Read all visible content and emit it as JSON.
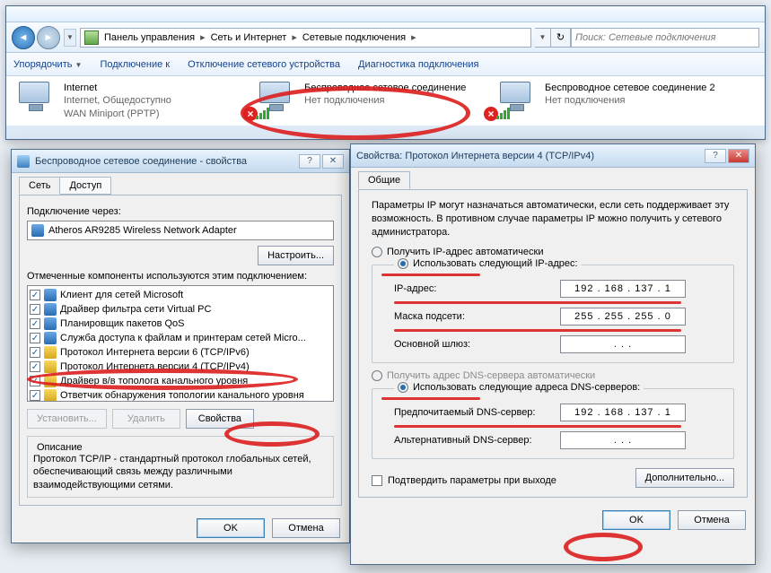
{
  "explorer": {
    "breadcrumb": [
      "Панель управления",
      "Сеть и Интернет",
      "Сетевые подключения"
    ],
    "search_placeholder": "Поиск: Сетевые подключения",
    "cmdbar": {
      "organize": "Упорядочить",
      "connect": "Подключение к",
      "disable": "Отключение сетевого устройства",
      "diagnose": "Диагностика подключения"
    },
    "items": [
      {
        "name": "Internet",
        "l2": "Internet, Общедоступно",
        "l3": "WAN Miniport (PPTP)",
        "red_x": false,
        "bars": false
      },
      {
        "name": "Беспроводное сетевое соединение",
        "l2": "Нет подключения",
        "l3": "",
        "red_x": true,
        "bars": true
      },
      {
        "name": "Беспроводное сетевое соединение 2",
        "l2": "Нет подключения",
        "l3": "",
        "red_x": true,
        "bars": true
      }
    ]
  },
  "dlg_props": {
    "title": "Беспроводное сетевое соединение - свойства",
    "tabs": {
      "net": "Сеть",
      "access": "Доступ"
    },
    "connect_via": "Подключение через:",
    "adapter": "Atheros AR9285 Wireless Network Adapter",
    "configure": "Настроить...",
    "components_label": "Отмеченные компоненты используются этим подключением:",
    "components": [
      "Клиент для сетей Microsoft",
      "Драйвер фильтра сети Virtual PC",
      "Планировщик пакетов QoS",
      "Служба доступа к файлам и принтерам сетей Micro...",
      "Протокол Интернета версии 6 (TCP/IPv6)",
      "Протокол Интернета версии 4 (TCP/IPv4)",
      "Драйвер в/в тополога канального уровня",
      "Ответчик обнаружения топологии канального уровня"
    ],
    "install": "Установить...",
    "remove": "Удалить",
    "props": "Свойства",
    "desc_title": "Описание",
    "desc": "Протокол TCP/IP - стандартный протокол глобальных сетей, обеспечивающий связь между различными взаимодействующими сетями.",
    "ok": "OK",
    "cancel": "Отмена"
  },
  "dlg_ip": {
    "title": "Свойства: Протокол Интернета версии 4 (TCP/IPv4)",
    "tabs": {
      "general": "Общие"
    },
    "para": "Параметры IP могут назначаться автоматически, если сеть поддерживает эту возможность. В противном случае параметры IP можно получить у сетевого администратора.",
    "r_auto_ip": "Получить IP-адрес автоматически",
    "r_use_ip": "Использовать следующий IP-адрес:",
    "ip_label": "IP-адрес:",
    "ip_val": "192 . 168 . 137 .   1",
    "mask_label": "Маска подсети:",
    "mask_val": "255 . 255 . 255 .   0",
    "gw_label": "Основной шлюз:",
    "gw_val": "   .    .    .   ",
    "r_auto_dns": "Получить адрес DNS-сервера автоматически",
    "r_use_dns": "Использовать следующие адреса DNS-серверов:",
    "dns1_label": "Предпочитаемый DNS-сервер:",
    "dns1_val": "192 . 168 . 137 .   1",
    "dns2_label": "Альтернативный DNS-сервер:",
    "dns2_val": "   .    .    .   ",
    "validate": "Подтвердить параметры при выходе",
    "advanced": "Дополнительно...",
    "ok": "OK",
    "cancel": "Отмена"
  }
}
